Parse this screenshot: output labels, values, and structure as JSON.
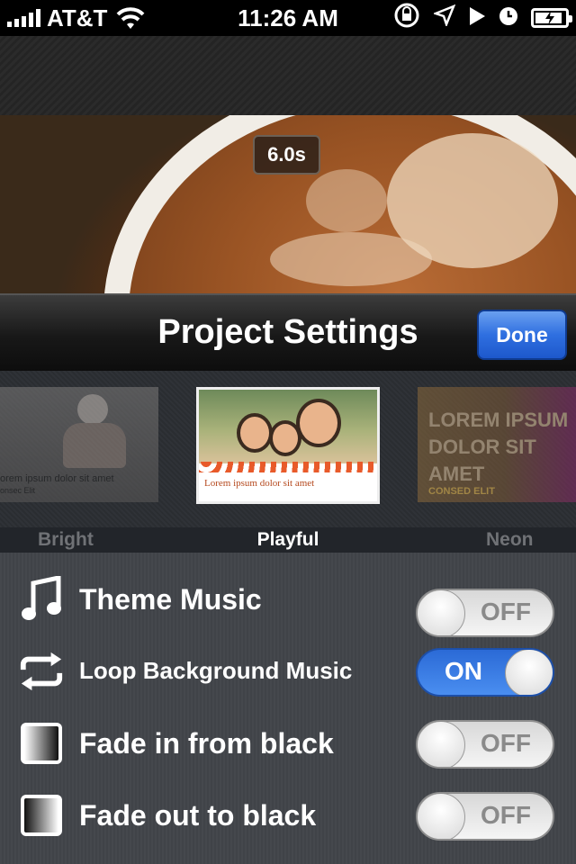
{
  "status_bar": {
    "carrier": "AT&T",
    "time": "11:26 AM",
    "battery_level": 0.8,
    "icons": [
      "signal-bars-icon",
      "wifi-icon",
      "rotation-lock-icon",
      "location-arrow-icon",
      "play-icon",
      "alarm-clock-icon",
      "battery-charging-icon"
    ]
  },
  "preview": {
    "duration": "6.0s"
  },
  "header": {
    "title": "Project Settings",
    "done_label": "Done"
  },
  "themes": {
    "selected": "Playful",
    "items": [
      {
        "label": "Bright",
        "caption": "orem ipsum dolor sit amet",
        "subcaption": "onsec Elit"
      },
      {
        "label": "Playful",
        "caption": "Lorem ipsum dolor sit amet"
      },
      {
        "label": "Neon",
        "caption": "LOREM IPSUM DOLOR SIT AMET",
        "subcaption": "CONSED ELIT"
      }
    ]
  },
  "settings": {
    "rows": [
      {
        "label": "Theme Music",
        "icon": "music-note-icon",
        "state": "OFF"
      },
      {
        "label": "Loop Background Music",
        "icon": "loop-arrows-icon",
        "state": "ON"
      },
      {
        "label": "Fade in from black",
        "icon": "fade-in-icon",
        "state": "OFF"
      },
      {
        "label": "Fade out to black",
        "icon": "fade-out-icon",
        "state": "OFF"
      }
    ]
  },
  "colors": {
    "accent_blue": "#2f6fe0",
    "toggle_on": "#3a7ee6",
    "selected_label": "#ffffff",
    "unselected_label": "#707276"
  }
}
